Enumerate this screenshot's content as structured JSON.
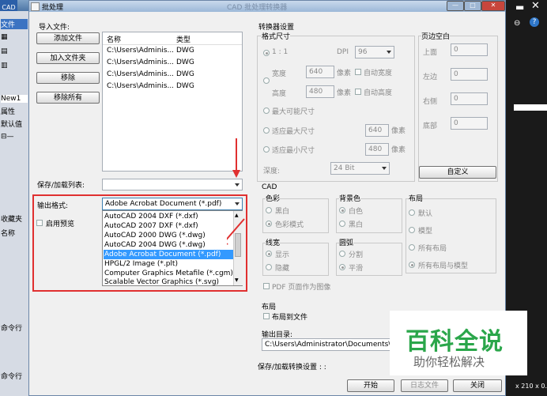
{
  "bg_app": {
    "cad_label": "CAD",
    "file_menu": "文件",
    "tab_new": "New1",
    "props": "属性",
    "default": "默认值",
    "collect": "收藏夹",
    "name": "名称",
    "cmd1": "命令行",
    "cmd2": "命令行",
    "size_text": "x 210 x 0.",
    "title_faded": "CAD 批处理转换器"
  },
  "dialog": {
    "title": "批处理",
    "import_label": "导入文件:",
    "buttons": {
      "add_file": "添加文件",
      "add_folder": "加入文件夹",
      "remove": "移除",
      "remove_all": "移除所有",
      "custom": "自定义",
      "start": "开始",
      "log": "日志文件",
      "close": "关闭"
    },
    "file_table": {
      "col_name": "名称",
      "col_type": "类型",
      "rows": [
        {
          "name": "C:\\Users\\Adminis...",
          "type": "DWG"
        },
        {
          "name": "C:\\Users\\Adminis...",
          "type": "DWG"
        },
        {
          "name": "C:\\Users\\Adminis...",
          "type": "DWG"
        },
        {
          "name": "C:\\Users\\Adminis...",
          "type": "DWG"
        }
      ]
    },
    "save_load_label": "保存/加载列表:",
    "output_format_label": "输出格式:",
    "output_format_selected": "Adobe Acrobat Document (*.pdf)",
    "format_options": [
      "AutoCAD 2004 DXF (*.dxf)",
      "AutoCAD 2007 DXF (*.dxf)",
      "AutoCAD 2000 DWG (*.dwg)",
      "AutoCAD 2004 DWG (*.dwg)",
      "Adobe Acrobat Document (*.pdf)",
      "HPGL/2 Image (*.plt)",
      "Computer Graphics Metafile (*.cgm)",
      "Scalable Vector Graphics (*.svg)"
    ],
    "selected_format_index": 4,
    "enable_preview": "启用预览",
    "converter": {
      "title": "转换器设置",
      "format_size": "格式尺寸",
      "ratio": "1 : 1",
      "dpi_label": "DPI",
      "dpi_value": "96",
      "width_label": "宽度",
      "width_value": "640",
      "height_label": "高度",
      "height_value": "480",
      "pixel": "像素",
      "auto_width": "自动宽度",
      "auto_height": "自动高度",
      "max_size": "最大可能尺寸",
      "fit_max": "适应最大尺寸",
      "fit_min": "适应最小尺寸",
      "fit_max_value": "640",
      "fit_min_value": "480",
      "depth_label": "深度:",
      "depth_value": "24 Bit"
    },
    "margins": {
      "title": "页边空白",
      "top": "上面",
      "left": "左边",
      "right": "右侧",
      "bottom": "底部",
      "top_v": "0",
      "left_v": "0",
      "right_v": "0",
      "bottom_v": "0"
    },
    "cad": {
      "title": "CAD",
      "color": "色彩",
      "bw": "黑白",
      "color_mode": "色彩模式",
      "bg_color": "背景色",
      "white": "白色",
      "black": "黑白",
      "layout": "布局",
      "default": "默认",
      "model": "模型",
      "all_layouts": "所有布局",
      "all_layouts_model": "所有布局与模型",
      "linewidth": "线宽",
      "show": "显示",
      "hide": "隐藏",
      "arc": "圆弧",
      "segment": "分割",
      "smooth": "平滑",
      "pdf_as_image": "PDF 页面作为图像"
    },
    "layout_section": {
      "title": "布局",
      "layout_to_file": "布局到文件"
    },
    "output_dir_label": "输出目录:",
    "output_dir_value": "C:\\Users\\Administrator\\Documents\\CA",
    "save_load_settings": "保存/加载转换设置 : :"
  },
  "watermark": {
    "title": "百科全说",
    "subtitle": "助你轻松解决"
  },
  "colors": {
    "highlight": "#3399ff",
    "annotation_red": "#e03030",
    "watermark_green": "#2aa64a"
  }
}
